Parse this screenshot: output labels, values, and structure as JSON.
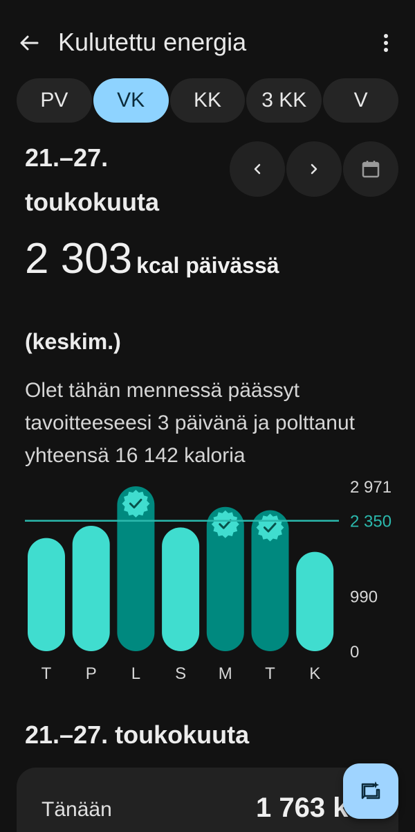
{
  "header": {
    "title": "Kulutettu energia"
  },
  "tabs": [
    {
      "label": "PV",
      "active": false
    },
    {
      "label": "VK",
      "active": true
    },
    {
      "label": "KK",
      "active": false
    },
    {
      "label": "3 KK",
      "active": false
    },
    {
      "label": "V",
      "active": false
    }
  ],
  "range": {
    "label": "21.–27. toukokuuta"
  },
  "summary": {
    "value": "2 303",
    "unit": "kcal päivässä",
    "avg_label": "(keskim.)",
    "description": "Olet tähän mennessä päässyt tavoitteeseesi 3 päivänä ja polttanut yhteensä 16 142 kaloria"
  },
  "chart_data": {
    "type": "bar",
    "categories": [
      "T",
      "P",
      "L",
      "S",
      "M",
      "T",
      "K"
    ],
    "values": [
      2040,
      2260,
      2971,
      2230,
      2600,
      2540,
      1790
    ],
    "goal_reached": [
      false,
      false,
      true,
      false,
      true,
      true,
      false
    ],
    "goal": 2350,
    "yticks": [
      "2 971",
      "990",
      "0"
    ],
    "goal_label": "2 350",
    "ylim": [
      0,
      2971
    ]
  },
  "colors": {
    "bar": "#40ddcf",
    "bar_goal": "#00897f",
    "goal_line": "#2bb9ad",
    "accent": "#8ed3ff"
  },
  "list": {
    "title": "21.–27. toukokuuta",
    "rows": [
      {
        "label": "Tänään",
        "value": "1 763 kcal"
      }
    ]
  },
  "icons": {
    "back": "arrow-left-icon",
    "more": "more-vert-icon",
    "prev": "chevron-left-icon",
    "next": "chevron-right-icon",
    "calendar": "calendar-icon",
    "fab": "chat-sparkle-icon"
  }
}
